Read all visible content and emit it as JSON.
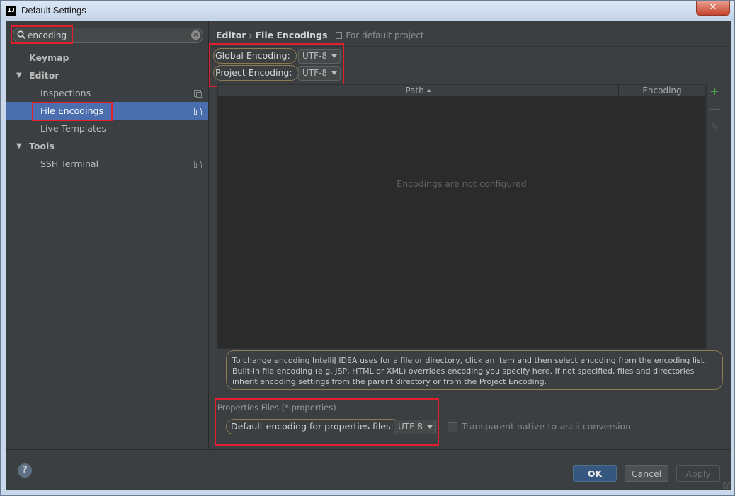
{
  "window": {
    "title": "Default Settings",
    "app_icon_text": "IJ",
    "close_symbol": "✕"
  },
  "search": {
    "value": "encoding",
    "placeholder": ""
  },
  "sidebar": {
    "items": [
      {
        "label": "Keymap"
      },
      {
        "label": "Editor"
      },
      {
        "label": "Inspections"
      },
      {
        "label": "File Encodings"
      },
      {
        "label": "Live Templates"
      },
      {
        "label": "Tools"
      },
      {
        "label": "SSH Terminal"
      }
    ],
    "expand_arrow": "▼"
  },
  "breadcrumb": {
    "parent": "Editor",
    "separator": "›",
    "current": "File Encodings",
    "note": "For default project"
  },
  "encodings": {
    "global_label": "Global Encoding:",
    "global_value": "UTF-8",
    "project_label": "Project Encoding:",
    "project_value": "UTF-8"
  },
  "table": {
    "columns": [
      "Path",
      "Encoding"
    ],
    "empty_text": "Encodings are not configured"
  },
  "toolbar": {
    "add_symbol": "+",
    "remove_symbol": "—",
    "edit_symbol": "✎"
  },
  "info_text": "To change encoding IntelliJ IDEA uses for a file or directory, click an item and then select encoding from the encoding list. Built-in file encoding (e.g. JSP, HTML or XML) overrides encoding you specify here. If not specified, files and directories inherit encoding settings from the parent directory or from the Project Encoding.",
  "properties": {
    "group_title": "Properties Files (*.properties)",
    "default_label": "Default encoding for properties files:",
    "default_value": "UTF-8",
    "native_to_ascii_label": "Transparent native-to-ascii conversion",
    "native_to_ascii_checked": false
  },
  "buttons": {
    "help": "?",
    "ok": "OK",
    "cancel": "Cancel",
    "apply": "Apply"
  },
  "colors": {
    "background": "#3c3f41",
    "selection": "#4b6eaf",
    "highlight_box": "#e01e2e",
    "add_icon": "#4caf50"
  }
}
